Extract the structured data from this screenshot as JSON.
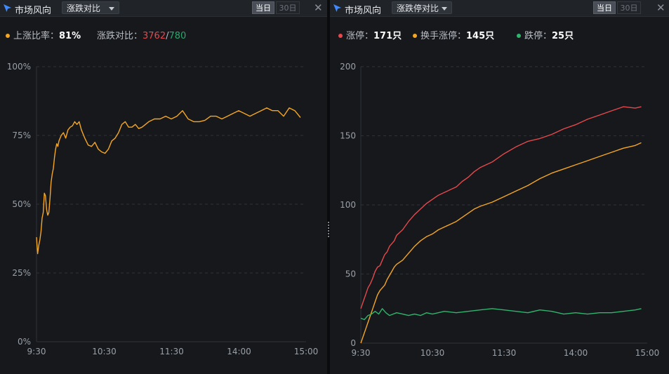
{
  "left_panel": {
    "title": "市场风向",
    "selector": "涨跌对比",
    "segments": [
      "当日",
      "30日"
    ],
    "close_glyph": "✕",
    "legend": {
      "ratio_label": "上涨比率：",
      "ratio_value": "81%",
      "compare_label": "涨跌对比：",
      "up_count": "3762",
      "separator": "/",
      "down_count": "780"
    }
  },
  "right_panel": {
    "title": "市场风向",
    "selector": "涨跌停对比",
    "segments": [
      "当日",
      "30日"
    ],
    "close_glyph": "✕",
    "legend": [
      {
        "label": "涨停：",
        "value": "171只"
      },
      {
        "label": "换手涨停：",
        "value": "145只"
      },
      {
        "label": "跌停：",
        "value": "25只"
      }
    ]
  },
  "colors": {
    "up": "#e6484c",
    "down": "#2aa86a",
    "orange": "#f5a623",
    "green": "#2fb56d",
    "grid": "#2e3238",
    "axis_text": "#9aa0a8"
  },
  "chart_data": [
    {
      "type": "line",
      "ylim": [
        0,
        100
      ],
      "yticks": [
        "100%",
        "75%",
        "50%",
        "25%",
        "0%"
      ],
      "yvalues": [
        100,
        75,
        50,
        25,
        0
      ],
      "xticks": [
        "9:30",
        "10:30",
        "11:30",
        "14:00",
        "15:00"
      ],
      "xlim": [
        0,
        240
      ],
      "grid": true,
      "series": [
        {
          "name": "上涨比率",
          "color": "#f5a623",
          "x": [
            0,
            1,
            2,
            3,
            4,
            5,
            6,
            7,
            8,
            9,
            10,
            11,
            12,
            13,
            14,
            15,
            16,
            17,
            18,
            19,
            20,
            22,
            24,
            26,
            28,
            30,
            32,
            34,
            36,
            38,
            40,
            43,
            46,
            49,
            52,
            55,
            58,
            61,
            64,
            67,
            70,
            73,
            76,
            79,
            82,
            85,
            88,
            91,
            94,
            97,
            100,
            105,
            110,
            115,
            120,
            125,
            130,
            135,
            140,
            145,
            150,
            155,
            160,
            165,
            170,
            175,
            180,
            185,
            190,
            195,
            200,
            205,
            210,
            215,
            220,
            225,
            230,
            235
          ],
          "y": [
            38,
            32,
            35,
            37,
            40,
            45,
            47,
            54,
            53,
            48,
            46,
            47,
            52,
            58,
            61,
            63,
            67,
            70,
            72,
            71,
            73,
            75,
            76,
            74,
            77,
            78,
            78.5,
            80,
            79,
            80,
            77,
            74,
            71.5,
            71,
            72.5,
            70,
            69,
            68.5,
            70,
            73,
            74,
            76,
            79,
            80,
            78,
            78,
            79,
            77.5,
            78,
            79,
            80,
            81,
            81,
            82,
            81,
            82,
            84,
            81,
            80,
            80,
            80.5,
            82,
            82,
            81,
            82,
            83,
            84,
            83,
            82,
            83,
            84,
            85,
            84,
            84,
            82,
            85,
            84,
            81.5
          ]
        }
      ]
    },
    {
      "type": "line",
      "ylim": [
        0,
        200
      ],
      "yticks": [
        "200",
        "150",
        "100",
        "50",
        "0"
      ],
      "yvalues": [
        200,
        150,
        100,
        50,
        0
      ],
      "xticks": [
        "9:30",
        "10:30",
        "11:30",
        "14:00",
        "15:00"
      ],
      "xlim": [
        0,
        240
      ],
      "grid": true,
      "series": [
        {
          "name": "涨停",
          "color": "#e6484c",
          "x": [
            0,
            2,
            4,
            6,
            8,
            10,
            12,
            14,
            16,
            18,
            20,
            22,
            24,
            26,
            28,
            30,
            35,
            40,
            45,
            50,
            55,
            60,
            65,
            70,
            75,
            80,
            85,
            90,
            95,
            100,
            110,
            120,
            130,
            140,
            150,
            160,
            170,
            180,
            190,
            200,
            210,
            220,
            230,
            235
          ],
          "y": [
            25,
            30,
            35,
            40,
            43,
            47,
            52,
            55,
            56,
            60,
            64,
            66,
            70,
            72,
            74,
            78,
            82,
            88,
            93,
            97,
            101,
            104,
            107,
            109,
            111,
            113,
            117,
            120,
            124,
            127,
            131,
            137,
            142,
            146,
            148,
            151,
            155,
            158,
            162,
            165,
            168,
            171,
            170,
            171
          ]
        },
        {
          "name": "换手涨停",
          "color": "#f5a623",
          "x": [
            0,
            2,
            4,
            6,
            8,
            10,
            12,
            14,
            16,
            18,
            20,
            22,
            24,
            26,
            28,
            30,
            35,
            40,
            45,
            50,
            55,
            60,
            65,
            70,
            75,
            80,
            85,
            90,
            95,
            100,
            110,
            120,
            130,
            140,
            150,
            160,
            170,
            180,
            190,
            200,
            210,
            220,
            230,
            235
          ],
          "y": [
            0,
            5,
            10,
            15,
            20,
            25,
            30,
            35,
            38,
            40,
            42,
            46,
            49,
            52,
            55,
            57,
            60,
            65,
            70,
            74,
            77,
            79,
            82,
            84,
            86,
            88,
            91,
            94,
            97,
            99,
            102,
            106,
            110,
            114,
            119,
            123,
            126,
            129,
            132,
            135,
            138,
            141,
            143,
            145
          ]
        },
        {
          "name": "跌停",
          "color": "#2fb56d",
          "x": [
            0,
            3,
            6,
            9,
            12,
            15,
            18,
            21,
            24,
            27,
            30,
            35,
            40,
            45,
            50,
            55,
            60,
            70,
            80,
            90,
            100,
            110,
            120,
            130,
            140,
            150,
            160,
            170,
            180,
            190,
            200,
            210,
            220,
            230,
            235
          ],
          "y": [
            18,
            17,
            20,
            21,
            23,
            21,
            25,
            22,
            20,
            21,
            22,
            21,
            20,
            21,
            20,
            22,
            21,
            23,
            22,
            23,
            24,
            25,
            24,
            23,
            22,
            24,
            23,
            21,
            22,
            21,
            22,
            22,
            23,
            24,
            25
          ]
        }
      ]
    }
  ]
}
